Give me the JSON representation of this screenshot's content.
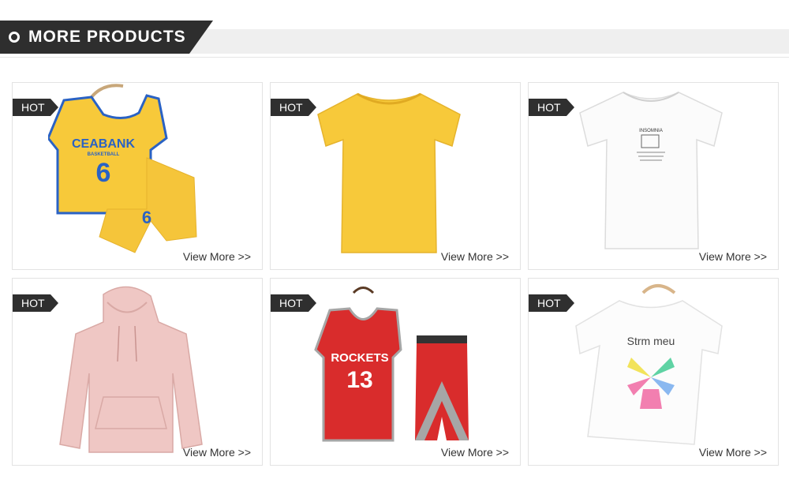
{
  "header": {
    "title": "MORE PRODUCTS"
  },
  "cards": [
    {
      "badge": "HOT",
      "link": "View More >>",
      "product": "yellow-basketball-set-icon",
      "jersey_text": "CEABANK",
      "jersey_sub": "BASKETBALL",
      "jersey_number": "6"
    },
    {
      "badge": "HOT",
      "link": "View More >>",
      "product": "yellow-tshirt-icon"
    },
    {
      "badge": "HOT",
      "link": "View More >>",
      "product": "white-tshirt-icon",
      "print_text": "INSOMNIA"
    },
    {
      "badge": "HOT",
      "link": "View More >>",
      "product": "pink-hoodie-icon"
    },
    {
      "badge": "HOT",
      "link": "View More >>",
      "product": "red-basketball-set-icon",
      "jersey_text": "ROCKETS",
      "jersey_number": "13"
    },
    {
      "badge": "HOT",
      "link": "View More >>",
      "product": "kids-white-tshirt-icon",
      "print_text": "Strm meu"
    }
  ],
  "colors": {
    "header_dark": "#2e2e2e",
    "band_gray": "#efefef",
    "yellow": "#f7c93a",
    "red": "#d92c2c",
    "pink": "#efc7c4"
  }
}
